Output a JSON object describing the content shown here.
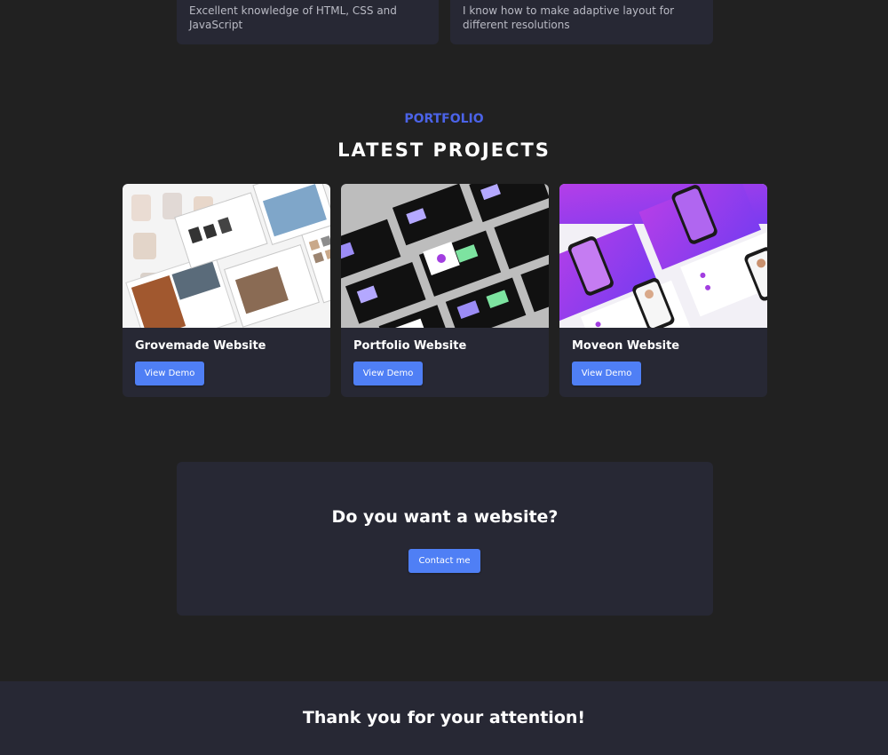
{
  "skills": [
    {
      "text": "Excellent knowledge of HTML, CSS and JavaScript"
    },
    {
      "text": "I know how to make adaptive layout for different resolutions"
    }
  ],
  "portfolio": {
    "eyebrow": "PORTFOLIO",
    "title": "LATEST PROJECTS",
    "projects": [
      {
        "title": "Grovemade Website",
        "button": "View Demo",
        "thumbnail": "grovemade-screenshot"
      },
      {
        "title": "Portfolio Website",
        "button": "View Demo",
        "thumbnail": "portfolio-screenshot"
      },
      {
        "title": "Moveon Website",
        "button": "View Demo",
        "thumbnail": "moveon-screenshot"
      }
    ]
  },
  "cta": {
    "title": "Do you want a website?",
    "button": "Contact me"
  },
  "footer": {
    "text": "Thank you for your attention!"
  },
  "colors": {
    "background": "#212121",
    "card": "#272834",
    "accent": "#4b63e8",
    "button": "#4f7ff5"
  }
}
